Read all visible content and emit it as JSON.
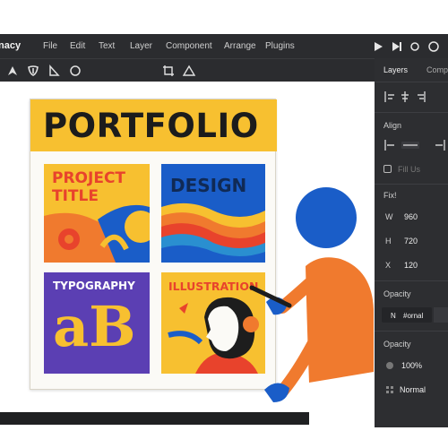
{
  "app": {
    "name": "nacy"
  },
  "menu": [
    "File",
    "Edit",
    "Text",
    "Layer",
    "Component",
    "Arrange",
    "Plugins"
  ],
  "toolbar": {
    "left_icons": [
      "pen-tool-icon",
      "shield-icon",
      "triangle-icon",
      "circle-icon"
    ],
    "mid_icons": [
      "crop-icon",
      "triangle-icon"
    ],
    "right_icons": [
      "play-icon",
      "present-icon",
      "record-icon",
      "help-icon"
    ]
  },
  "panel": {
    "tabs": [
      "Layers",
      "Comp"
    ],
    "align_label": "Align",
    "fill_label": "Fill",
    "fill_partial": "Fill  Us",
    "fix_label": "Fix!",
    "fields": [
      {
        "label": "W",
        "value": "960"
      },
      {
        "label": "H",
        "value": "720"
      },
      {
        "label": "X",
        "value": "120"
      }
    ],
    "opacity_label": "Opacity",
    "blend_label": "N",
    "blend_value": "#ornal",
    "opacity_label2": "Opacity",
    "opacity_value": "100%",
    "blend_mode": "Normal"
  },
  "artboard": {
    "title": "PORTFOLIO",
    "cards": [
      {
        "label_line1": "PROJECT",
        "label_line2": "TITLE"
      },
      {
        "label_line1": "DESIGN"
      },
      {
        "label_line1": "TYPOGRAPHY",
        "glyphs": "aB"
      },
      {
        "label_line1": "ILLUSTRATION"
      }
    ]
  },
  "colors": {
    "chrome": "#2b2c2f",
    "panel": "#2d2e31",
    "yellow": "#f7c030",
    "orange": "#f07a2e",
    "blue": "#1a5dc8",
    "purple": "#5b3fb3",
    "red": "#e8432c"
  }
}
